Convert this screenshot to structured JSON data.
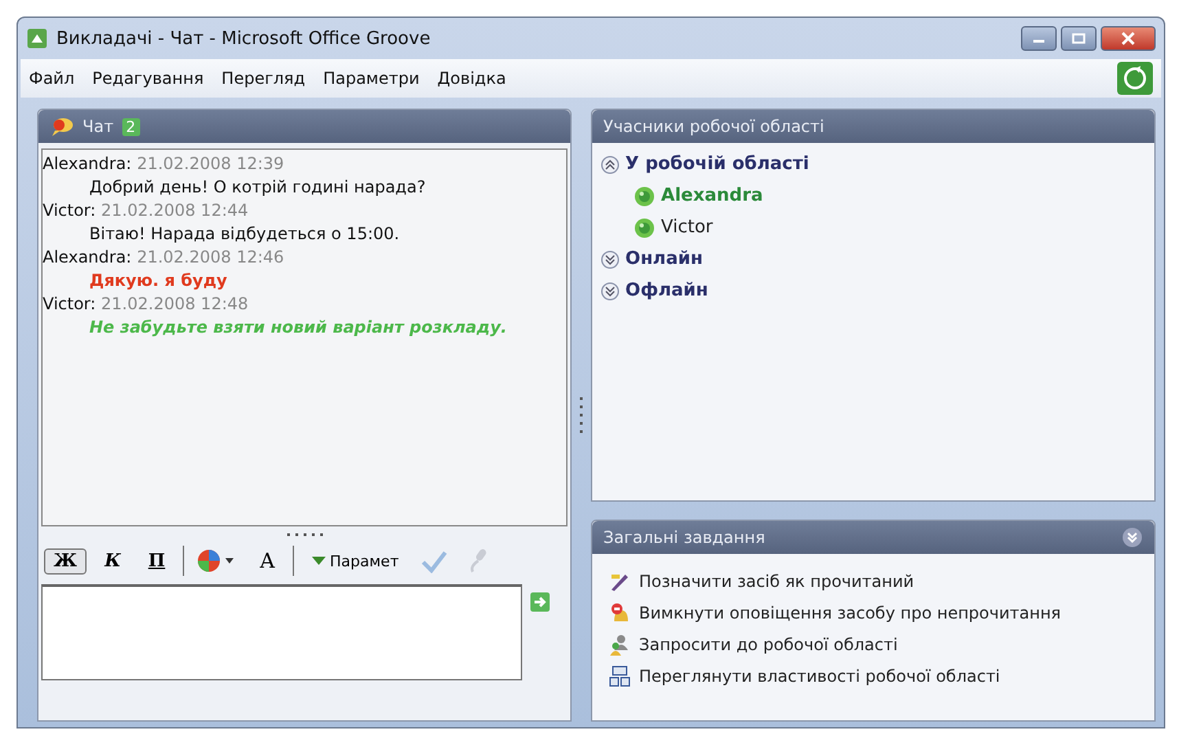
{
  "window": {
    "title": "Викладачі - Чат - Microsoft Office Groove"
  },
  "menu": [
    {
      "label": "Файл"
    },
    {
      "label": "Редагування"
    },
    {
      "label": "Перегляд"
    },
    {
      "label": "Параметри"
    },
    {
      "label": "Довідка"
    }
  ],
  "chat": {
    "title": "Чат",
    "badge": "2",
    "messages": [
      {
        "author": "Alexandra:",
        "time": "21.02.2008 12:39",
        "text": "Добрий день! О котрій годині нарада?",
        "kind": "plain",
        "color": "#111111"
      },
      {
        "author": "Victor:",
        "time": "21.02.2008 12:44",
        "text": "Вітаю! Нарада відбудеться о 15:00.",
        "kind": "plain",
        "color": "#111111"
      },
      {
        "author": "Alexandra:",
        "time": "21.02.2008 12:46",
        "text": "Дякую. я буду",
        "kind": "bold",
        "color": "#e03a1e"
      },
      {
        "author": "Victor:",
        "time": "21.02.2008 12:48",
        "text": "Не забудьте взяти новий варіант розкладу.",
        "kind": "bold-italic",
        "color": "#4cb84a"
      }
    ],
    "toolbar": [
      {
        "kind": "bold",
        "label": "Ж",
        "selected": true
      },
      {
        "kind": "italic",
        "label": "К",
        "selected": false
      },
      {
        "kind": "underline",
        "label": "П",
        "selected": false
      },
      {
        "kind": "sep"
      },
      {
        "kind": "color"
      },
      {
        "kind": "size",
        "label": "A"
      },
      {
        "kind": "sep"
      },
      {
        "kind": "options",
        "label": "Парамет"
      },
      {
        "kind": "spell"
      },
      {
        "kind": "mic"
      }
    ]
  },
  "members": {
    "title": "Учасники робочої області",
    "groups": [
      {
        "label": "У робочій області",
        "expanded": true,
        "children": [
          {
            "name": "Alexandra",
            "current": true
          },
          {
            "name": "Victor",
            "current": false
          }
        ]
      },
      {
        "label": "Онлайн",
        "expanded": false
      },
      {
        "label": "Офлайн",
        "expanded": false
      }
    ]
  },
  "tasks": {
    "title": "Загальні завдання",
    "items": [
      {
        "label": "Позначити засіб як прочитаний",
        "kind": "mark"
      },
      {
        "label": "Вимкнути оповіщення засобу про непрочитання",
        "kind": "alert"
      },
      {
        "label": "Запросити до робочої області",
        "kind": "invite"
      },
      {
        "label": "Переглянути властивості робочої області",
        "kind": "props"
      }
    ]
  }
}
